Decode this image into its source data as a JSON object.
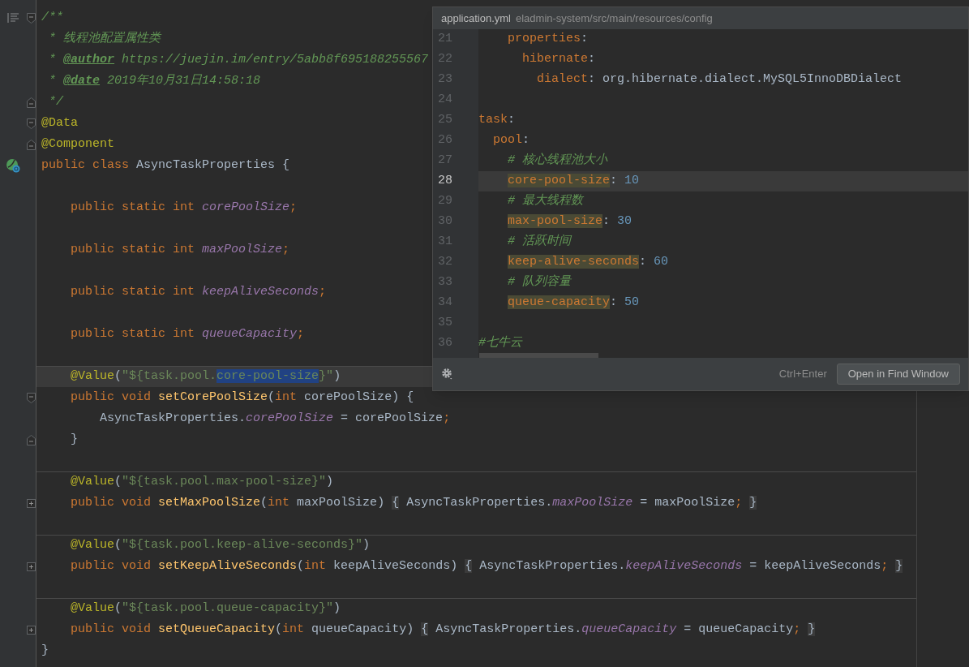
{
  "editor": {
    "lines": [
      {
        "kind": "fold-start",
        "current": false,
        "separator": false,
        "tokens": [
          {
            "kind": "comment",
            "text": "/**"
          }
        ]
      },
      {
        "kind": "code",
        "current": false,
        "separator": false,
        "tokens": [
          {
            "kind": "comment",
            "text": " * 线程池配置属性类"
          }
        ]
      },
      {
        "kind": "code",
        "current": false,
        "separator": false,
        "tokens": [
          {
            "kind": "comment",
            "text": " * "
          },
          {
            "kind": "doctag",
            "text": "@author"
          },
          {
            "kind": "comment",
            "text": " https://juejin.im/entry/5abb8f695188255567"
          }
        ]
      },
      {
        "kind": "code",
        "current": false,
        "separator": false,
        "tokens": [
          {
            "kind": "comment",
            "text": " * "
          },
          {
            "kind": "doctag",
            "text": "@date"
          },
          {
            "kind": "comment",
            "text": " 2019年10月31日14:58:18"
          }
        ]
      },
      {
        "kind": "fold-end",
        "current": false,
        "separator": false,
        "tokens": [
          {
            "kind": "comment",
            "text": " */"
          }
        ]
      },
      {
        "kind": "fold-start",
        "current": false,
        "separator": false,
        "tokens": [
          {
            "kind": "annotation",
            "text": "@Data"
          }
        ]
      },
      {
        "kind": "fold-end",
        "current": false,
        "separator": false,
        "tokens": [
          {
            "kind": "annotation",
            "text": "@Component"
          }
        ]
      },
      {
        "kind": "class",
        "current": false,
        "separator": false,
        "tokens": [
          {
            "kind": "keyword",
            "text": "public class "
          },
          {
            "kind": "plain",
            "text": "AsyncTaskProperties {"
          }
        ]
      },
      {
        "kind": "code",
        "current": false,
        "separator": false
      },
      {
        "kind": "code",
        "current": false,
        "separator": false,
        "tokens": [
          {
            "kind": "keyword",
            "text": "    public static int "
          },
          {
            "kind": "field",
            "text": "corePoolSize"
          },
          {
            "kind": "keyword",
            "text": ";"
          }
        ]
      },
      {
        "kind": "code",
        "current": false,
        "separator": false
      },
      {
        "kind": "code",
        "current": false,
        "separator": false,
        "tokens": [
          {
            "kind": "keyword",
            "text": "    public static int "
          },
          {
            "kind": "field",
            "text": "maxPoolSize"
          },
          {
            "kind": "keyword",
            "text": ";"
          }
        ]
      },
      {
        "kind": "code",
        "current": false,
        "separator": false
      },
      {
        "kind": "code",
        "current": false,
        "separator": false,
        "tokens": [
          {
            "kind": "keyword",
            "text": "    public static int "
          },
          {
            "kind": "field",
            "text": "keepAliveSeconds"
          },
          {
            "kind": "keyword",
            "text": ";"
          }
        ]
      },
      {
        "kind": "code",
        "current": false,
        "separator": false
      },
      {
        "kind": "code",
        "current": false,
        "separator": false,
        "tokens": [
          {
            "kind": "keyword",
            "text": "    public static int "
          },
          {
            "kind": "field",
            "text": "queueCapacity"
          },
          {
            "kind": "keyword",
            "text": ";"
          }
        ]
      },
      {
        "kind": "code",
        "current": false,
        "separator": false
      },
      {
        "kind": "code",
        "current": true,
        "separator": true,
        "tokens": [
          {
            "kind": "annotation",
            "text": "    @Value"
          },
          {
            "kind": "plain",
            "text": "("
          },
          {
            "kind": "string",
            "text": "\"${task.pool."
          },
          {
            "kind": "selected",
            "text": "core-pool-size"
          },
          {
            "kind": "string",
            "text": "}\""
          },
          {
            "kind": "plain",
            "text": ")"
          }
        ]
      },
      {
        "kind": "fold-start",
        "current": false,
        "separator": false,
        "tokens": [
          {
            "kind": "keyword",
            "text": "    public void "
          },
          {
            "kind": "method",
            "text": "setCorePoolSize"
          },
          {
            "kind": "plain",
            "text": "("
          },
          {
            "kind": "keyword",
            "text": "int "
          },
          {
            "kind": "plain",
            "text": "corePoolSize) {"
          }
        ]
      },
      {
        "kind": "code",
        "current": false,
        "separator": false,
        "tokens": [
          {
            "kind": "plain",
            "text": "        AsyncTaskProperties."
          },
          {
            "kind": "field",
            "text": "corePoolSize"
          },
          {
            "kind": "plain",
            "text": " = corePoolSize"
          },
          {
            "kind": "keyword",
            "text": ";"
          }
        ]
      },
      {
        "kind": "fold-end",
        "current": false,
        "separator": false,
        "tokens": [
          {
            "kind": "plain",
            "text": "    }"
          }
        ]
      },
      {
        "kind": "code",
        "current": false,
        "separator": false
      },
      {
        "kind": "code",
        "current": false,
        "separator": true,
        "tokens": [
          {
            "kind": "annotation",
            "text": "    @Value"
          },
          {
            "kind": "plain",
            "text": "("
          },
          {
            "kind": "string",
            "text": "\"${task.pool.max-pool-size}\""
          },
          {
            "kind": "plain",
            "text": ")"
          }
        ]
      },
      {
        "kind": "folded",
        "current": false,
        "separator": false,
        "tokens": [
          {
            "kind": "keyword",
            "text": "    public void "
          },
          {
            "kind": "method",
            "text": "setMaxPoolSize"
          },
          {
            "kind": "plain",
            "text": "("
          },
          {
            "kind": "keyword",
            "text": "int "
          },
          {
            "kind": "plain",
            "text": "maxPoolSize) "
          },
          {
            "kind": "folded",
            "text": "{"
          },
          {
            "kind": "plain",
            "text": " AsyncTaskProperties."
          },
          {
            "kind": "field",
            "text": "maxPoolSize"
          },
          {
            "kind": "plain",
            "text": " = maxPoolSize"
          },
          {
            "kind": "keyword",
            "text": ";"
          },
          {
            "kind": "folded",
            "text": " }"
          }
        ]
      },
      {
        "kind": "code",
        "current": false,
        "separator": false
      },
      {
        "kind": "code",
        "current": false,
        "separator": true,
        "tokens": [
          {
            "kind": "annotation",
            "text": "    @Value"
          },
          {
            "kind": "plain",
            "text": "("
          },
          {
            "kind": "string",
            "text": "\"${task.pool.keep-alive-seconds}\""
          },
          {
            "kind": "plain",
            "text": ")"
          }
        ]
      },
      {
        "kind": "folded",
        "current": false,
        "separator": false,
        "tokens": [
          {
            "kind": "keyword",
            "text": "    public void "
          },
          {
            "kind": "method",
            "text": "setKeepAliveSeconds"
          },
          {
            "kind": "plain",
            "text": "("
          },
          {
            "kind": "keyword",
            "text": "int "
          },
          {
            "kind": "plain",
            "text": "keepAliveSeconds) "
          },
          {
            "kind": "folded",
            "text": "{"
          },
          {
            "kind": "plain",
            "text": " AsyncTaskProperties."
          },
          {
            "kind": "field",
            "text": "keepAliveSeconds"
          },
          {
            "kind": "plain",
            "text": " = keepAliveSeconds"
          },
          {
            "kind": "keyword",
            "text": ";"
          },
          {
            "kind": "folded",
            "text": " }"
          }
        ]
      },
      {
        "kind": "code",
        "current": false,
        "separator": false
      },
      {
        "kind": "code",
        "current": false,
        "separator": true,
        "tokens": [
          {
            "kind": "annotation",
            "text": "    @Value"
          },
          {
            "kind": "plain",
            "text": "("
          },
          {
            "kind": "string",
            "text": "\"${task.pool.queue-capacity}\""
          },
          {
            "kind": "plain",
            "text": ")"
          }
        ]
      },
      {
        "kind": "folded",
        "current": false,
        "separator": false,
        "tokens": [
          {
            "kind": "keyword",
            "text": "    public void "
          },
          {
            "kind": "method",
            "text": "setQueueCapacity"
          },
          {
            "kind": "plain",
            "text": "("
          },
          {
            "kind": "keyword",
            "text": "int "
          },
          {
            "kind": "plain",
            "text": "queueCapacity) "
          },
          {
            "kind": "folded",
            "text": "{"
          },
          {
            "kind": "plain",
            "text": " AsyncTaskProperties."
          },
          {
            "kind": "field",
            "text": "queueCapacity"
          },
          {
            "kind": "plain",
            "text": " = queueCapacity"
          },
          {
            "kind": "keyword",
            "text": ";"
          },
          {
            "kind": "folded",
            "text": " }"
          }
        ]
      },
      {
        "kind": "code",
        "current": false,
        "separator": false,
        "tokens": [
          {
            "kind": "plain",
            "text": "}"
          }
        ]
      }
    ]
  },
  "popup": {
    "file": "application.yml",
    "path": "eladmin-system/src/main/resources/config",
    "lines": [
      {
        "number": "21",
        "current": false,
        "tokens": [
          {
            "kind": "key",
            "text": "    properties"
          },
          {
            "kind": "plain",
            "text": ":"
          }
        ]
      },
      {
        "number": "22",
        "current": false,
        "tokens": [
          {
            "kind": "key",
            "text": "      hibernate"
          },
          {
            "kind": "plain",
            "text": ":"
          }
        ]
      },
      {
        "number": "23",
        "current": false,
        "tokens": [
          {
            "kind": "key",
            "text": "        dialect"
          },
          {
            "kind": "plain",
            "text": ": org.hibernate.dialect.MySQL5InnoDBDialect"
          }
        ]
      },
      {
        "number": "24",
        "current": false
      },
      {
        "number": "25",
        "current": false,
        "tokens": [
          {
            "kind": "key",
            "text": "task"
          },
          {
            "kind": "plain",
            "text": ":"
          }
        ]
      },
      {
        "number": "26",
        "current": false,
        "tokens": [
          {
            "kind": "key",
            "text": "  pool"
          },
          {
            "kind": "plain",
            "text": ":"
          }
        ]
      },
      {
        "number": "27",
        "current": false,
        "tokens": [
          {
            "kind": "comment",
            "text": "    # 核心线程池大小"
          }
        ]
      },
      {
        "number": "28",
        "current": true,
        "tokens": [
          {
            "kind": "match",
            "text": "    core-pool-size"
          },
          {
            "kind": "plain",
            "text": ": "
          },
          {
            "kind": "number",
            "text": "10"
          }
        ]
      },
      {
        "number": "29",
        "current": false,
        "tokens": [
          {
            "kind": "comment",
            "text": "    # 最大线程数"
          }
        ]
      },
      {
        "number": "30",
        "current": false,
        "tokens": [
          {
            "kind": "match",
            "text": "    max-pool-size"
          },
          {
            "kind": "plain",
            "text": ": "
          },
          {
            "kind": "number",
            "text": "30"
          }
        ]
      },
      {
        "number": "31",
        "current": false,
        "tokens": [
          {
            "kind": "comment",
            "text": "    # 活跃时间"
          }
        ]
      },
      {
        "number": "32",
        "current": false,
        "tokens": [
          {
            "kind": "match",
            "text": "    keep-alive-seconds"
          },
          {
            "kind": "plain",
            "text": ": "
          },
          {
            "kind": "number",
            "text": "60"
          }
        ]
      },
      {
        "number": "33",
        "current": false,
        "tokens": [
          {
            "kind": "comment",
            "text": "    # 队列容量"
          }
        ]
      },
      {
        "number": "34",
        "current": false,
        "tokens": [
          {
            "kind": "match",
            "text": "    queue-capacity"
          },
          {
            "kind": "plain",
            "text": ": "
          },
          {
            "kind": "number",
            "text": "50"
          }
        ]
      },
      {
        "number": "35",
        "current": false
      },
      {
        "number": "36",
        "current": false,
        "tokens": [
          {
            "kind": "comment",
            "text": "#七牛云"
          }
        ]
      }
    ],
    "shortcut": "Ctrl+Enter",
    "button": "Open in Find Window"
  }
}
